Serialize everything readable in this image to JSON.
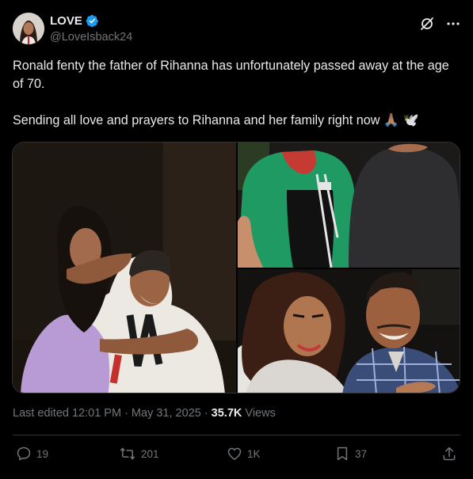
{
  "author": {
    "display_name": "LOVE",
    "handle": "@LoveIsback24",
    "verified": true
  },
  "header_icons": [
    "grok-icon",
    "more-icon"
  ],
  "post": {
    "line1": "Ronald fenty the father of Rihanna has unfortunately passed away at the age of 70.",
    "line2": "Sending all love and prayers to Rihanna and her family right now 🙏🏽 🕊️"
  },
  "meta": {
    "edited": "Last edited 12:01 PM · May 31, 2025 · ",
    "views_count": "35.7K",
    "views_label": " Views"
  },
  "actions": {
    "replies": "19",
    "reposts": "201",
    "likes": "1K",
    "bookmarks": "37"
  },
  "colors": {
    "background": "#000000",
    "text": "#e7e9ea",
    "muted": "#71767b",
    "verified": "#1d9bf0",
    "border": "#2f3336"
  }
}
